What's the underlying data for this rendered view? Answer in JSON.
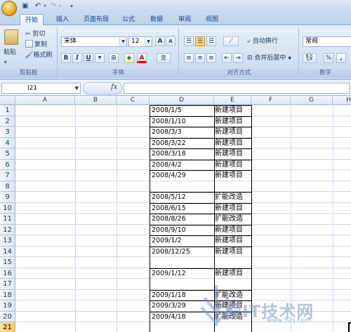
{
  "tabs": [
    "开始",
    "插入",
    "页面布局",
    "公式",
    "数据",
    "审阅",
    "视图"
  ],
  "active_tab": 0,
  "clipboard": {
    "paste_label": "粘贴",
    "cut_label": "剪切",
    "copy_label": "复制",
    "format_painter_label": "格式刷",
    "group_label": "剪贴板"
  },
  "font": {
    "font_name": "宋体",
    "font_size": "12",
    "grow": "A",
    "shrink": "A",
    "bold": "B",
    "italic": "I",
    "underline": "U",
    "phonetic": "变",
    "group_label": "字体"
  },
  "alignment": {
    "wrap_text_label": "自动换行",
    "merge_label": "合并后居中",
    "group_label": "对齐方式"
  },
  "number": {
    "format_value": "常规",
    "percent": "%",
    "comma": ",",
    "group_label": "数字"
  },
  "formula_bar": {
    "name_box": "I21",
    "fx": "fx",
    "formula": ""
  },
  "columns": [
    "A",
    "B",
    "C",
    "D",
    "E",
    "F",
    "G",
    "H"
  ],
  "rows": [
    "1",
    "2",
    "3",
    "4",
    "5",
    "6",
    "7",
    "8",
    "9",
    "10",
    "11",
    "12",
    "13",
    "14",
    "15",
    "16",
    "17",
    "18",
    "19",
    "20",
    "21"
  ],
  "selected_row": "21",
  "entries": [
    {
      "date": "2008/1/5",
      "type": "新建项目"
    },
    {
      "date": "2008/1/10",
      "type": "新建项目"
    },
    {
      "date": "2008/3/3",
      "type": "新建项目"
    },
    {
      "date": "2008/3/22",
      "type": "新建项目"
    },
    {
      "date": "2008/3/18",
      "type": "新建项目"
    },
    {
      "date": "2008/4/2",
      "type": "新建项目"
    },
    {
      "date": "2008/4/29",
      "type": "新建项目"
    },
    {
      "date": "2008/5/12",
      "type": "扩能改造"
    },
    {
      "date": "2008/6/15",
      "type": "新建项目"
    },
    {
      "date": "2008/8/26",
      "type": "扩能改造"
    },
    {
      "date": "2008/9/10",
      "type": "新建项目"
    },
    {
      "date": "2009/1/2",
      "type": "新建项目"
    },
    {
      "date": "2008/12/25",
      "type": "新建项目"
    },
    {
      "date": "2009/1/12",
      "type": "新建项目"
    },
    {
      "date": "2009/1/18",
      "type": "扩能改造"
    },
    {
      "date": "2009/3/29",
      "type": "新建项目"
    },
    {
      "date": "2009/4/18",
      "type": "扩能改造"
    }
  ],
  "watermark": {
    "text": "爱IT技术网",
    "url": "www.52ij.com"
  },
  "colors": {
    "ribbon_bg": "#d5e3f4",
    "tab_text": "#15428b",
    "grid_line": "#d0d7e5",
    "selected_row_header": "#f7c95f"
  }
}
